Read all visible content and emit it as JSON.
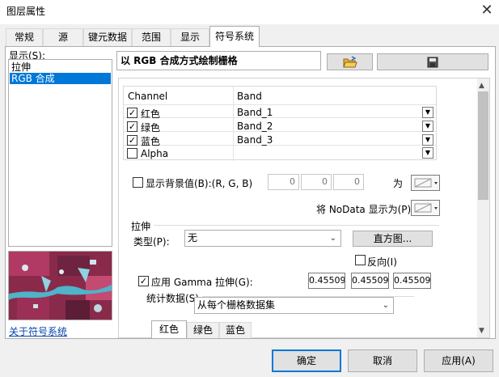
{
  "window": {
    "title": "图层属性",
    "close_icon": "✕"
  },
  "tabs": [
    "常规",
    "源",
    "键元数据",
    "范围",
    "显示",
    "符号系统"
  ],
  "active_tab": 5,
  "left_panel": {
    "show_label": "显示(S):",
    "items": [
      "拉伸",
      "RGB 合成"
    ],
    "selected_index": 1,
    "help_link": "关于符号系统"
  },
  "main": {
    "heading": "以 RGB 合成方式绘制栅格",
    "open_icon": "folder-open-icon",
    "save_icon": "save-disk-icon",
    "grid": {
      "col_channel": "Channel",
      "col_band": "Band",
      "rows": [
        {
          "channel": "红色",
          "band": "Band_1",
          "checked": true
        },
        {
          "channel": "绿色",
          "band": "Band_2",
          "checked": true
        },
        {
          "channel": "蓝色",
          "band": "Band_3",
          "checked": true
        },
        {
          "channel": "Alpha",
          "band": "",
          "checked": false
        }
      ]
    },
    "background": {
      "label": "显示背景值(B):(R, G, B)",
      "r": "0",
      "g": "0",
      "b": "0",
      "as_label": "为"
    },
    "nodata_label": "将 NoData 显示为(P)",
    "stretch": {
      "group_title": "拉伸",
      "type_label": "类型(P):",
      "type_value": "无",
      "histogram_button": "直方图...",
      "invert_label": "反向(I)",
      "gamma_label": "应用 Gamma 拉伸(G):",
      "gamma_values": [
        "0.45509",
        "0.45509",
        "0.45509"
      ]
    },
    "stats": {
      "label": "统计数据(S)",
      "value": "从每个栅格数据集",
      "subtabs": [
        "红色",
        "绿色",
        "蓝色"
      ]
    }
  },
  "buttons": {
    "ok": "确定",
    "cancel": "取消",
    "apply": "应用(A)"
  },
  "colors": {
    "accent": "#0078d7",
    "panel": "#f0f0f0",
    "link": "#0645ad"
  }
}
